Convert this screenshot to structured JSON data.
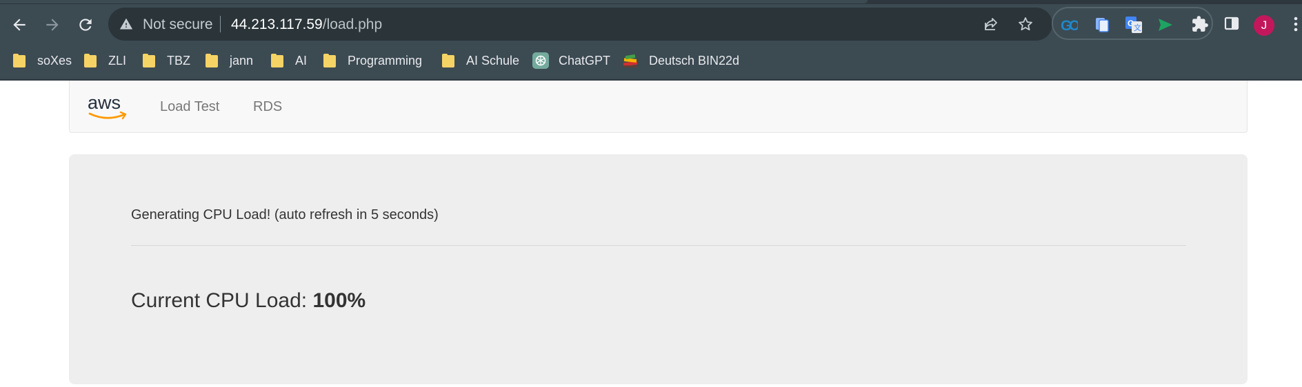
{
  "browser": {
    "security_label": "Not secure",
    "url_host": "44.213.117.59",
    "url_path": "/load.php",
    "avatar_initial": "J",
    "extensions": [
      "go-extension-icon",
      "clipboard-extension-icon",
      "google-translate-icon",
      "send-extension-icon"
    ]
  },
  "bookmarks": [
    {
      "label": "soXes",
      "icon": "folder-icon"
    },
    {
      "label": "ZLI",
      "icon": "folder-icon"
    },
    {
      "label": "TBZ",
      "icon": "folder-icon"
    },
    {
      "label": "jann",
      "icon": "folder-icon"
    },
    {
      "label": "AI",
      "icon": "folder-icon"
    },
    {
      "label": "Programming",
      "icon": "folder-icon"
    },
    {
      "label": "AI Schule",
      "icon": "folder-icon"
    },
    {
      "label": "ChatGPT",
      "icon": "chatgpt-icon"
    },
    {
      "label": "Deutsch BIN22d",
      "icon": "books-icon"
    }
  ],
  "page": {
    "brand": "aws",
    "nav": [
      "Load Test",
      "RDS"
    ],
    "status_message": "Generating CPU Load! (auto refresh in 5 seconds)",
    "cpu_label": "Current CPU Load: ",
    "cpu_value": "100%"
  },
  "colors": {
    "chrome_bg": "#3c4a52",
    "omnibox_bg": "#2a3439",
    "aws_orange": "#ff9900",
    "jumbotron_bg": "#eeeeee",
    "avatar": "#c2185b"
  }
}
